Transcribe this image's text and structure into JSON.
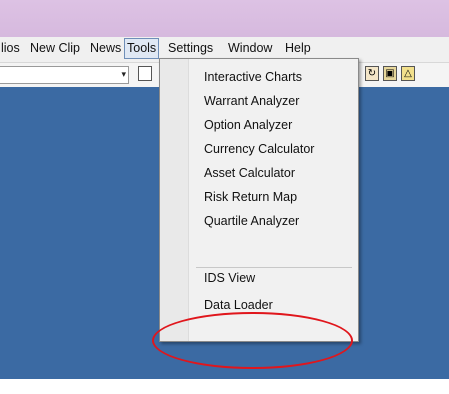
{
  "menubar": {
    "items": [
      "lios",
      "New Clip",
      "News",
      "Tools",
      "Settings",
      "Window",
      "Help"
    ]
  },
  "toolbar": {
    "combo_arrow": "▾",
    "icons": [
      "page-icon",
      "refresh-icon",
      "chart-icon",
      "warning-icon"
    ]
  },
  "tools_menu": {
    "items": [
      "Interactive Charts",
      "Warrant Analyzer",
      "Option Analyzer",
      "Currency Calculator",
      "Asset Calculator",
      "Risk Return Map",
      "Quartile Analyzer",
      "IDS View",
      "Data Loader"
    ]
  },
  "colors": {
    "workspace": "#3b6aa3",
    "titlebar": "#d8bce0",
    "highlight_circle": "#e0161c"
  }
}
